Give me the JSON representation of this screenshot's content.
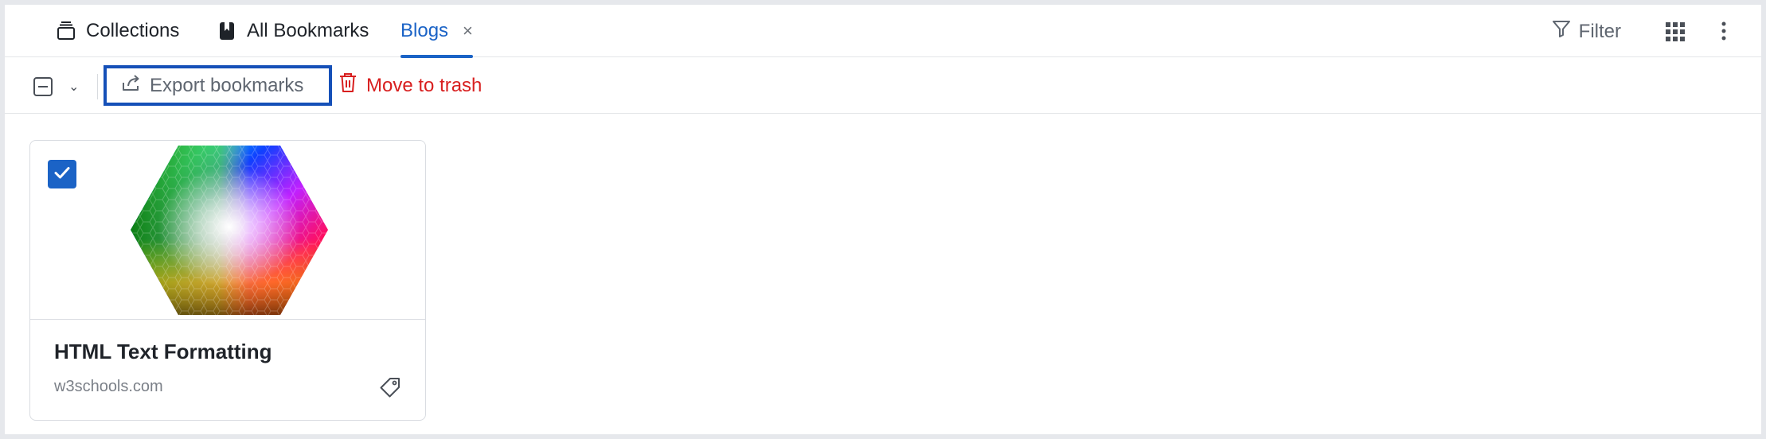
{
  "tabs": [
    {
      "label": "Collections",
      "icon": "collections-icon"
    },
    {
      "label": "All Bookmarks",
      "icon": "bookmark-icon"
    },
    {
      "label": "Blogs",
      "active": true,
      "close_label": "×"
    }
  ],
  "toolbar_right": {
    "filter_label": "Filter",
    "grid_icon": "grid-icon",
    "more_icon": "more-vertical-icon"
  },
  "actions": {
    "export_label": "Export bookmarks",
    "trash_label": "Move to trash",
    "caret": "⌄"
  },
  "card": {
    "selected": true,
    "title": "HTML Text Formatting",
    "domain": "w3schools.com",
    "thumbnail": "color-hexagon-image",
    "tag_icon": "tag-icon"
  },
  "colors": {
    "accent": "#1b63c6",
    "danger": "#d81f1f",
    "focus_outline": "#1550b8",
    "muted_text": "#5f6670"
  }
}
